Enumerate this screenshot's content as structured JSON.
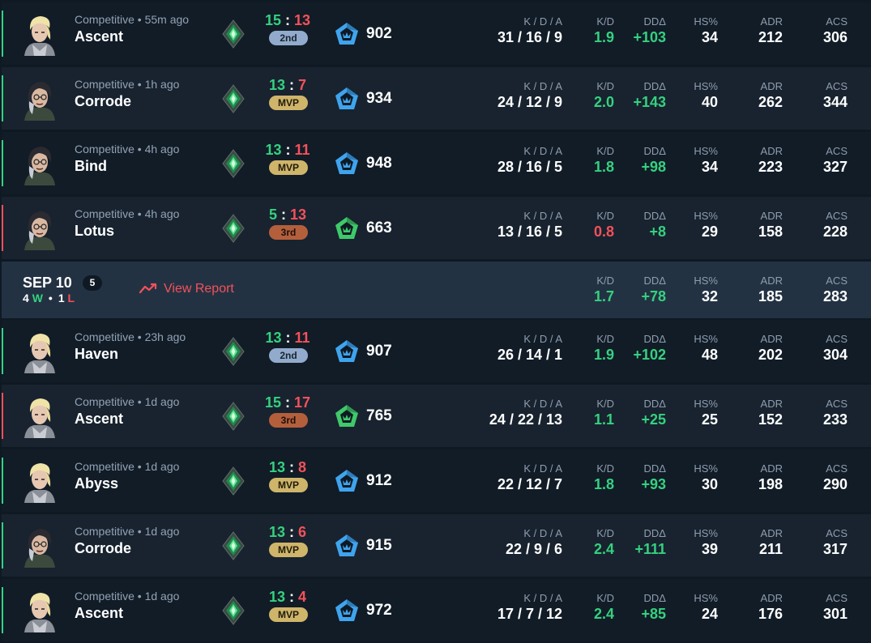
{
  "headers": {
    "kda": "K / D / A",
    "kd": "K/D",
    "dd": "DDΔ",
    "hs": "HS%",
    "adr": "ADR",
    "acs": "ACS"
  },
  "colors": {
    "win": "#34d282",
    "loss": "#f4515a",
    "mvp": "#cfb56a",
    "second": "#92abcc",
    "third": "#b45f3c"
  },
  "matches": [
    {
      "result": "win",
      "agent": "sova",
      "meta": "Competitive • 55m ago",
      "map": "Ascent",
      "score_a": "15",
      "score_b": "13",
      "badge": "2nd",
      "badge_style": "silver",
      "rank_tier": "emerald",
      "rr_icon": "blue-pentagon-icon",
      "rr": "902",
      "kda": "31 / 16 / 9",
      "kd": "1.9",
      "kd_color": "green",
      "dd": "+103",
      "hs": "34",
      "adr": "212",
      "acs": "306"
    },
    {
      "result": "win",
      "agent": "viper",
      "meta": "Competitive • 1h ago",
      "map": "Corrode",
      "score_a": "13",
      "score_b": "7",
      "badge": "MVP",
      "badge_style": "mvp",
      "rank_tier": "emerald",
      "rr_icon": "blue-pentagon-icon",
      "rr": "934",
      "kda": "24 / 12 / 9",
      "kd": "2.0",
      "kd_color": "green",
      "dd": "+143",
      "hs": "40",
      "adr": "262",
      "acs": "344"
    },
    {
      "result": "win",
      "agent": "viper",
      "meta": "Competitive • 4h ago",
      "map": "Bind",
      "score_a": "13",
      "score_b": "11",
      "badge": "MVP",
      "badge_style": "mvp",
      "rank_tier": "emerald",
      "rr_icon": "blue-pentagon-icon",
      "rr": "948",
      "kda": "28 / 16 / 5",
      "kd": "1.8",
      "kd_color": "green",
      "dd": "+98",
      "hs": "34",
      "adr": "223",
      "acs": "327"
    },
    {
      "result": "loss",
      "agent": "viper",
      "meta": "Competitive • 4h ago",
      "map": "Lotus",
      "score_a": "5",
      "score_b": "13",
      "badge": "3rd",
      "badge_style": "bronze",
      "rank_tier": "emerald",
      "rr_icon": "green-pentagon-icon",
      "rr": "663",
      "kda": "13 / 16 / 5",
      "kd": "0.8",
      "kd_color": "red",
      "dd": "+8",
      "hs": "29",
      "adr": "158",
      "acs": "228"
    }
  ],
  "day": {
    "date": "SEP 10",
    "count": "5",
    "wins": "4",
    "win_letter": "W",
    "losses": "1",
    "loss_letter": "L",
    "report_label": "View Report",
    "kd": "1.7",
    "dd": "+78",
    "hs": "32",
    "adr": "185",
    "acs": "283"
  },
  "matches2": [
    {
      "result": "win",
      "agent": "sova",
      "meta": "Competitive • 23h ago",
      "map": "Haven",
      "score_a": "13",
      "score_b": "11",
      "badge": "2nd",
      "badge_style": "silver",
      "rank_tier": "emerald",
      "rr_icon": "blue-pentagon-icon",
      "rr": "907",
      "kda": "26 / 14 / 1",
      "kd": "1.9",
      "kd_color": "green",
      "dd": "+102",
      "hs": "48",
      "adr": "202",
      "acs": "304"
    },
    {
      "result": "loss",
      "agent": "sova",
      "meta": "Competitive • 1d ago",
      "map": "Ascent",
      "score_a": "15",
      "score_b": "17",
      "badge": "3rd",
      "badge_style": "bronze",
      "rank_tier": "emerald",
      "rr_icon": "green-pentagon-icon",
      "rr": "765",
      "kda": "24 / 22 / 13",
      "kd": "1.1",
      "kd_color": "green",
      "dd": "+25",
      "hs": "25",
      "adr": "152",
      "acs": "233"
    },
    {
      "result": "win",
      "agent": "sova",
      "meta": "Competitive • 1d ago",
      "map": "Abyss",
      "score_a": "13",
      "score_b": "8",
      "badge": "MVP",
      "badge_style": "mvp",
      "rank_tier": "emerald",
      "rr_icon": "blue-pentagon-icon",
      "rr": "912",
      "kda": "22 / 12 / 7",
      "kd": "1.8",
      "kd_color": "green",
      "dd": "+93",
      "hs": "30",
      "adr": "198",
      "acs": "290"
    },
    {
      "result": "win",
      "agent": "viper",
      "meta": "Competitive • 1d ago",
      "map": "Corrode",
      "score_a": "13",
      "score_b": "6",
      "badge": "MVP",
      "badge_style": "mvp",
      "rank_tier": "emerald",
      "rr_icon": "blue-pentagon-icon",
      "rr": "915",
      "kda": "22 / 9 / 6",
      "kd": "2.4",
      "kd_color": "green",
      "dd": "+111",
      "hs": "39",
      "adr": "211",
      "acs": "317"
    },
    {
      "result": "win",
      "agent": "sova",
      "meta": "Competitive • 1d ago",
      "map": "Ascent",
      "score_a": "13",
      "score_b": "4",
      "badge": "MVP",
      "badge_style": "mvp",
      "rank_tier": "emerald",
      "rr_icon": "blue-pentagon-icon",
      "rr": "972",
      "kda": "17 / 7 / 12",
      "kd": "2.4",
      "kd_color": "green",
      "dd": "+85",
      "hs": "24",
      "adr": "176",
      "acs": "301"
    }
  ]
}
